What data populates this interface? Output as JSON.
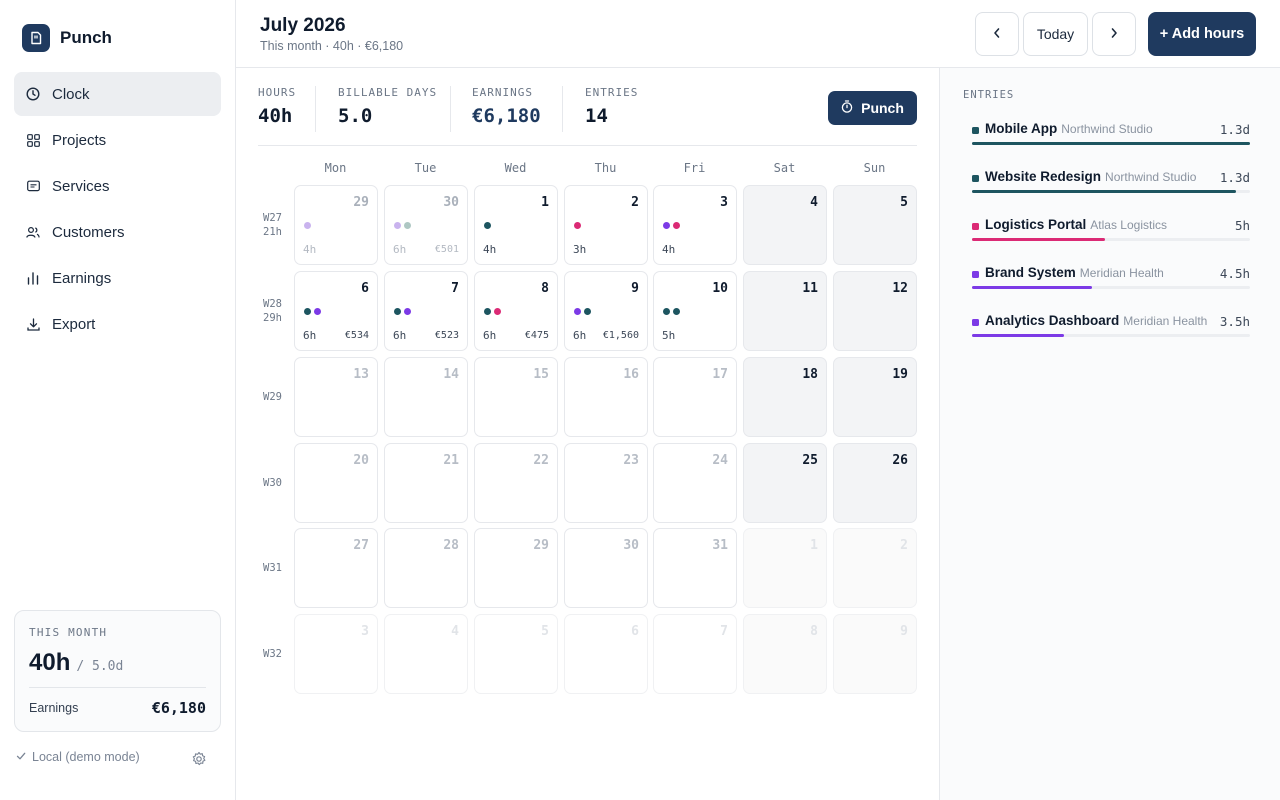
{
  "app": {
    "name": "Punch"
  },
  "nav": [
    {
      "label": "Clock",
      "icon": "clock-icon",
      "active": true
    },
    {
      "label": "Projects",
      "icon": "grid-icon",
      "active": false
    },
    {
      "label": "Services",
      "icon": "card-icon",
      "active": false
    },
    {
      "label": "Customers",
      "icon": "users-icon",
      "active": false
    },
    {
      "label": "Earnings",
      "icon": "bar-chart-icon",
      "active": false
    },
    {
      "label": "Export",
      "icon": "download-icon",
      "active": false
    }
  ],
  "month_card": {
    "label": "THIS MONTH",
    "hours": "40h",
    "days": "/ 5.0d",
    "earnings_label": "Earnings",
    "earnings_value": "€6,180"
  },
  "footer": {
    "mode": "Local (demo mode)"
  },
  "header": {
    "title": "July 2026",
    "subtitle": "This month · 40h · €6,180",
    "today_label": "Today",
    "add_label": "+ Add hours"
  },
  "stats": [
    {
      "label": "HOURS",
      "value": "40h"
    },
    {
      "label": "BILLABLE DAYS",
      "value": "5.0"
    },
    {
      "label": "EARNINGS",
      "value": "€6,180"
    },
    {
      "label": "ENTRIES",
      "value": "14"
    }
  ],
  "punch_label": "Punch",
  "colors": {
    "teal": "#1d5560",
    "lilac": "#c9b3ee",
    "sage": "#aec7c3",
    "pink": "#db2a75",
    "purple": "#7c3ae6",
    "brand": "#1f3a5f"
  },
  "weekdays": [
    "Mon",
    "Tue",
    "Wed",
    "Thu",
    "Fri",
    "Sat",
    "Sun"
  ],
  "weeks": [
    {
      "label": "W27",
      "hours": "21h",
      "days": [
        {
          "n": "29",
          "state": "past",
          "dots": [
            "lilac"
          ],
          "hours": "4h",
          "earn": ""
        },
        {
          "n": "30",
          "state": "past",
          "dots": [
            "lilac",
            "sage"
          ],
          "hours": "6h",
          "earn": "€501"
        },
        {
          "n": "1",
          "state": "active",
          "dots": [
            "teal"
          ],
          "hours": "4h",
          "earn": ""
        },
        {
          "n": "2",
          "state": "active",
          "dots": [
            "pink"
          ],
          "hours": "3h",
          "earn": ""
        },
        {
          "n": "3",
          "state": "active",
          "dots": [
            "purple",
            "pink"
          ],
          "hours": "4h",
          "earn": ""
        },
        {
          "n": "4",
          "state": "weekend",
          "dots": [],
          "hours": "",
          "earn": ""
        },
        {
          "n": "5",
          "state": "weekend",
          "dots": [],
          "hours": "",
          "earn": ""
        }
      ]
    },
    {
      "label": "W28",
      "hours": "29h",
      "days": [
        {
          "n": "6",
          "state": "active",
          "dots": [
            "teal",
            "purple"
          ],
          "hours": "6h",
          "earn": "€534"
        },
        {
          "n": "7",
          "state": "active",
          "dots": [
            "teal",
            "purple"
          ],
          "hours": "6h",
          "earn": "€523"
        },
        {
          "n": "8",
          "state": "active",
          "dots": [
            "teal",
            "pink"
          ],
          "hours": "6h",
          "earn": "€475"
        },
        {
          "n": "9",
          "state": "active",
          "dots": [
            "purple",
            "teal"
          ],
          "hours": "6h",
          "earn": "€1,560"
        },
        {
          "n": "10",
          "state": "active",
          "dots": [
            "teal",
            "teal"
          ],
          "hours": "5h",
          "earn": ""
        },
        {
          "n": "11",
          "state": "weekend",
          "dots": [],
          "hours": "",
          "earn": ""
        },
        {
          "n": "12",
          "state": "weekend",
          "dots": [],
          "hours": "",
          "earn": ""
        }
      ]
    },
    {
      "label": "W29",
      "hours": "",
      "days": [
        {
          "n": "13",
          "state": "empty"
        },
        {
          "n": "14",
          "state": "empty"
        },
        {
          "n": "15",
          "state": "empty"
        },
        {
          "n": "16",
          "state": "empty"
        },
        {
          "n": "17",
          "state": "empty"
        },
        {
          "n": "18",
          "state": "weekend"
        },
        {
          "n": "19",
          "state": "weekend"
        }
      ]
    },
    {
      "label": "W30",
      "hours": "",
      "days": [
        {
          "n": "20",
          "state": "empty"
        },
        {
          "n": "21",
          "state": "empty"
        },
        {
          "n": "22",
          "state": "empty"
        },
        {
          "n": "23",
          "state": "empty"
        },
        {
          "n": "24",
          "state": "empty"
        },
        {
          "n": "25",
          "state": "weekend"
        },
        {
          "n": "26",
          "state": "weekend"
        }
      ]
    },
    {
      "label": "W31",
      "hours": "",
      "days": [
        {
          "n": "27",
          "state": "empty"
        },
        {
          "n": "28",
          "state": "empty"
        },
        {
          "n": "29",
          "state": "empty"
        },
        {
          "n": "30",
          "state": "empty"
        },
        {
          "n": "31",
          "state": "empty"
        },
        {
          "n": "1",
          "state": "outside-weekend"
        },
        {
          "n": "2",
          "state": "outside-weekend"
        }
      ]
    },
    {
      "label": "W32",
      "hours": "",
      "days": [
        {
          "n": "3",
          "state": "outside"
        },
        {
          "n": "4",
          "state": "outside"
        },
        {
          "n": "5",
          "state": "outside"
        },
        {
          "n": "6",
          "state": "outside"
        },
        {
          "n": "7",
          "state": "outside"
        },
        {
          "n": "8",
          "state": "outside-weekend"
        },
        {
          "n": "9",
          "state": "outside-weekend"
        }
      ]
    }
  ],
  "entries_title": "ENTRIES",
  "entries": [
    {
      "name": "Mobile App",
      "client": "Northwind Studio",
      "amount": "1.3d",
      "color": "teal",
      "progress": 1.0
    },
    {
      "name": "Website Redesign",
      "client": "Northwind Studio",
      "amount": "1.3d",
      "color": "teal",
      "progress": 0.95
    },
    {
      "name": "Logistics Portal",
      "client": "Atlas Logistics",
      "amount": "5h",
      "color": "pink",
      "progress": 0.48
    },
    {
      "name": "Brand System",
      "client": "Meridian Health",
      "amount": "4.5h",
      "color": "purple",
      "progress": 0.43
    },
    {
      "name": "Analytics Dashboard",
      "client": "Meridian Health",
      "amount": "3.5h",
      "color": "purple",
      "progress": 0.33
    }
  ]
}
